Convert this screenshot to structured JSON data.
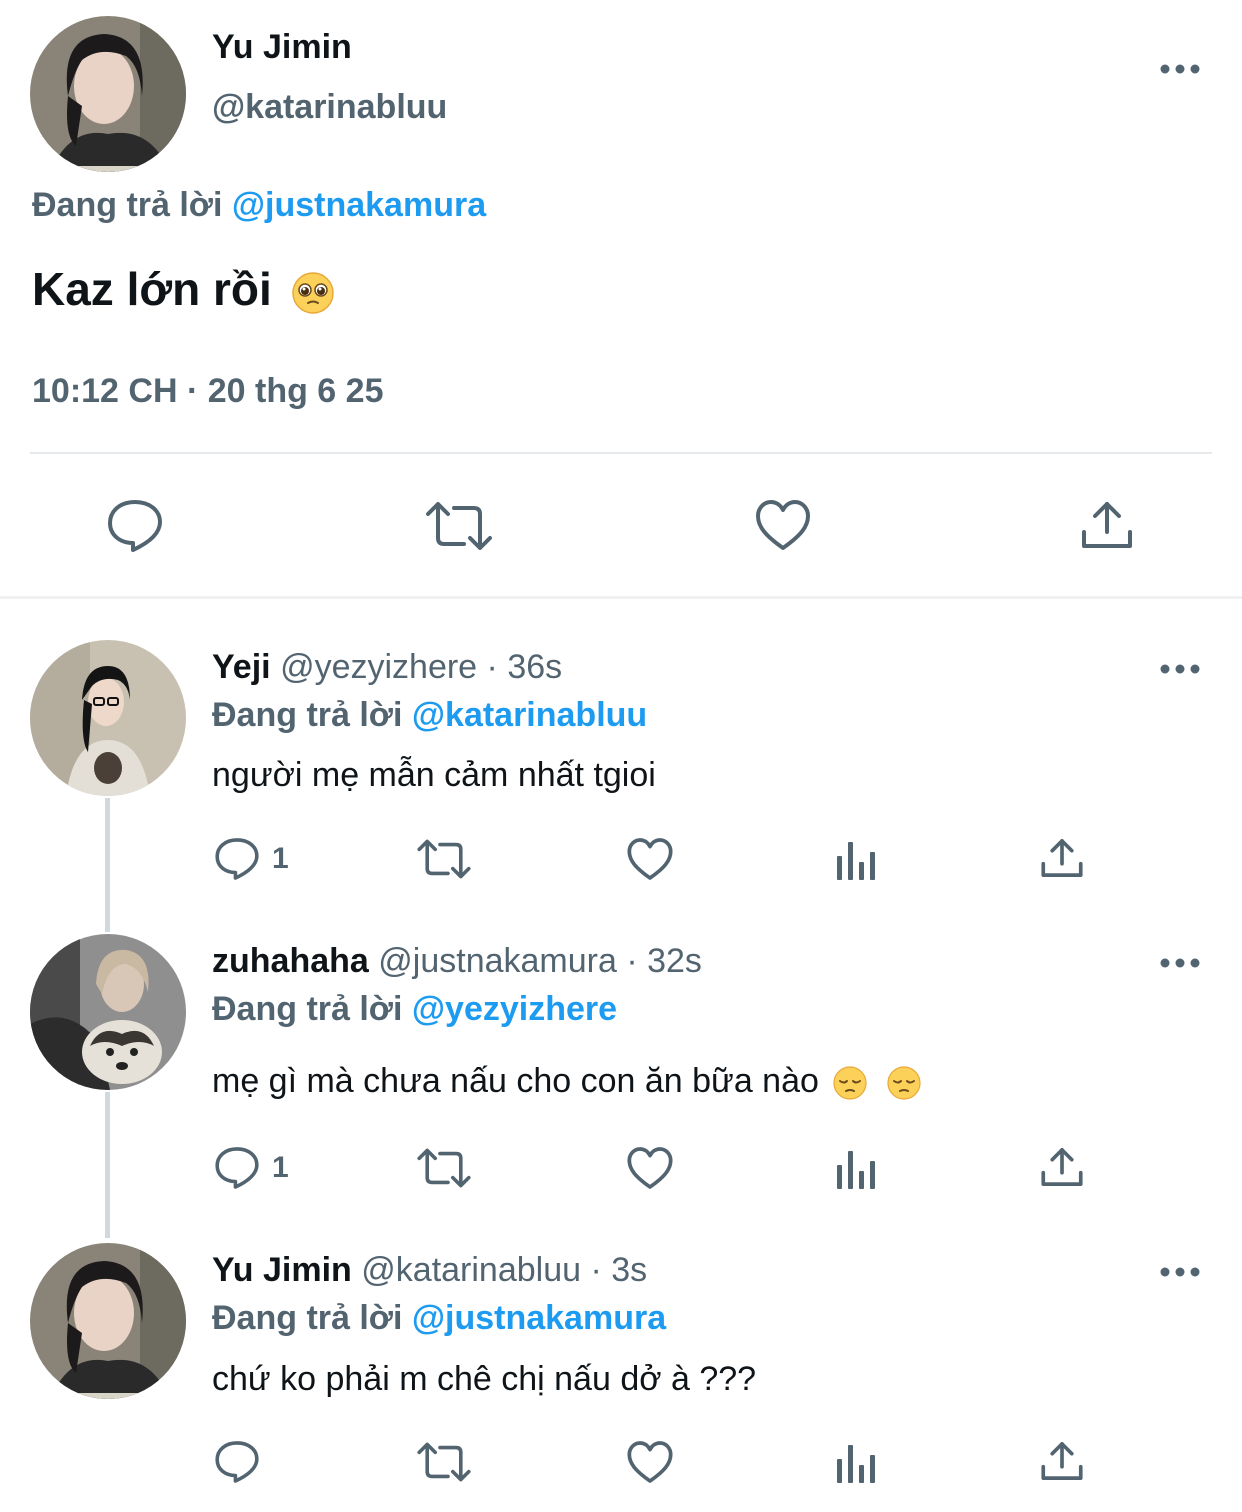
{
  "main_tweet": {
    "author_name": "Yu Jimin",
    "handle": "@katarinabluu",
    "replying_prefix": "Đang trả lời",
    "replying_to": "@justnakamura",
    "text": "Kaz lớn rồi",
    "emoji": "pleading-face",
    "timestamp": "10:12 CH · 20 thg 6 25",
    "more_icon": "more-horizontal-icon"
  },
  "replies": [
    {
      "author_name": "Yeji",
      "handle": "@yezyizhere",
      "time": "· 36s",
      "replying_prefix": "Đang trả lời",
      "replying_to": "@katarinabluu",
      "text": "người mẹ mẫn cảm nhất tgioi",
      "reply_count": "1"
    },
    {
      "author_name": "zuhahaha",
      "handle": "@justnakamura",
      "time": "· 32s",
      "replying_prefix": "Đang trả lời",
      "replying_to": "@yezyizhere",
      "text": "mẹ gì mà chưa nấu cho con ăn bữa nào",
      "emoji": "pensive-face",
      "reply_count": "1"
    },
    {
      "author_name": "Yu Jimin",
      "handle": "@katarinabluu",
      "time": "· 3s",
      "replying_prefix": "Đang trả lời",
      "replying_to": "@justnakamura",
      "text": "chứ ko phải m chê chị nấu dở à ???",
      "reply_count": ""
    }
  ],
  "colors": {
    "text_primary": "#0f1419",
    "text_secondary": "#536471",
    "accent": "#1d9bf0",
    "divider": "#e6e9ec"
  }
}
